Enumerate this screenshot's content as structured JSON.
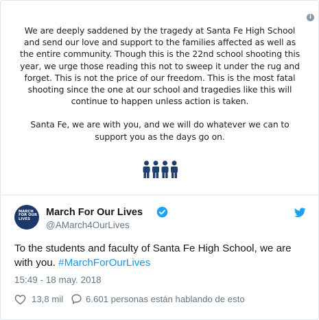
{
  "media": {
    "statement": [
      "We are deeply saddened by the tragedy at Santa Fe High School and send our love and support to the families affected as well as the entire community. Though this is the 22nd school shooting this year, we urge those reading this not to sweep it under the rug and forget. This is not the price of our freedom. This is the most fatal shooting since the one at our school and tragedies like this will continue to happen unless action is taken.",
      "Santa Fe, we are with you, and we will do whatever we can to support you as the days go on."
    ],
    "info_icon": "info-icon",
    "people_icon": "four-people-icon"
  },
  "author": {
    "avatar_lines": [
      "MARCH",
      "FOR OUR",
      "LIVES"
    ],
    "name": "March For Our Lives",
    "handle": "@AMarch4OurLives",
    "verified_icon": "verified-badge-icon",
    "brand_icon": "twitter-bird-icon"
  },
  "tweet": {
    "text": "To the students and faculty of Santa Fe High School, we are with you. ",
    "hashtag": "#MarchForOurLives",
    "timestamp": "15:49 - 18 may. 2018"
  },
  "actions": {
    "likes": "13,8 mil",
    "reply_text": "6.601 personas están hablando de esto"
  },
  "colors": {
    "link": "#1b95e0",
    "text": "#14171a",
    "muted": "#657786",
    "avatar_bg": "#1b3a6b",
    "icon_navy": "#1f3f6e"
  }
}
